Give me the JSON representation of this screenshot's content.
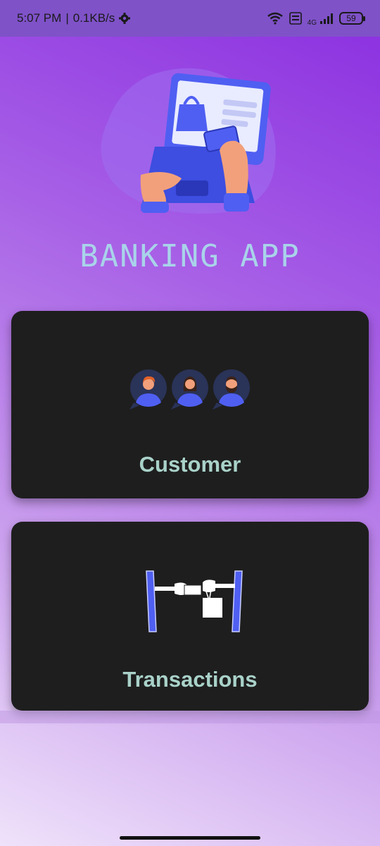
{
  "status_bar": {
    "time": "5:07 PM",
    "separator": "|",
    "speed": "0.1KB/s",
    "network": "4G",
    "battery": "59",
    "icons": [
      "gear-icon",
      "wifi-icon",
      "volte-icon",
      "signal-icon",
      "battery-icon"
    ]
  },
  "app": {
    "title": "BANKING APP"
  },
  "cards": {
    "customer": {
      "label": "Customer",
      "icon": "customers-icon"
    },
    "transactions": {
      "label": "Transactions",
      "icon": "transfer-icon"
    }
  },
  "colors": {
    "card_bg": "#1e1e1e",
    "card_label": "#a9d2c9",
    "title": "#a9d3ea",
    "accent": "#4f5ff2"
  }
}
